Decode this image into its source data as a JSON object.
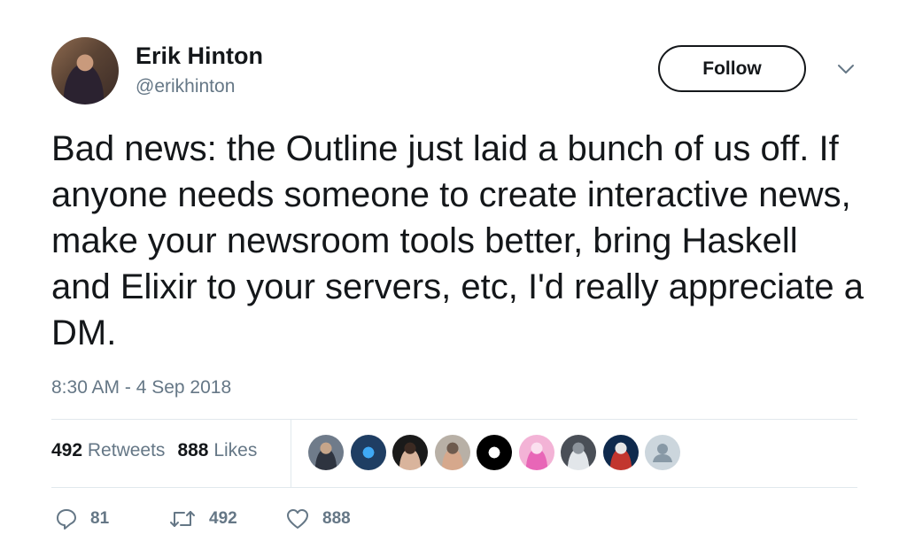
{
  "author": {
    "name": "Erik Hinton",
    "handle": "@erikhinton"
  },
  "follow_label": "Follow",
  "tweet_text": "Bad news: the Outline just laid a bunch of us off. If anyone needs someone to create interactive news, make your newsroom tools better, bring Haskell and Elixir to your servers, etc, I'd really appreciate a DM.",
  "timestamp": "8:30 AM - 4 Sep 2018",
  "stats": {
    "retweets_count": "492",
    "retweets_label": "Retweets",
    "likes_count": "888",
    "likes_label": "Likes"
  },
  "liker_avatars": [
    {
      "kind": "photo",
      "colors": [
        "#6f7b8a",
        "#2e3440",
        "#c6a58a"
      ]
    },
    {
      "kind": "logo",
      "colors": [
        "#1f3e63",
        "#3fa9f5",
        "#0c1a2b"
      ]
    },
    {
      "kind": "photo",
      "colors": [
        "#1a1a1a",
        "#d9b49c",
        "#3c2a22"
      ]
    },
    {
      "kind": "photo",
      "colors": [
        "#b8b0a6",
        "#d6a88c",
        "#6e5b4e"
      ]
    },
    {
      "kind": "logo",
      "colors": [
        "#000000",
        "#ffffff",
        "#222222"
      ]
    },
    {
      "kind": "photo",
      "colors": [
        "#f3b3d6",
        "#e866b7",
        "#fbe0ef"
      ]
    },
    {
      "kind": "photo",
      "colors": [
        "#4a4f57",
        "#e2e6ea",
        "#8d949c"
      ]
    },
    {
      "kind": "photo",
      "colors": [
        "#0f2a4d",
        "#c2362f",
        "#e6e6e6"
      ]
    },
    {
      "kind": "default",
      "colors": [
        "#ccd6dd",
        "#8899a6",
        "#ccd6dd"
      ]
    }
  ],
  "actions": {
    "reply_count": "81",
    "retweet_count": "492",
    "like_count": "888"
  },
  "colors": {
    "text": "#14171a",
    "secondary_text": "#657786",
    "divider": "#e1e8ed"
  },
  "icons": [
    "chevron-down-icon",
    "reply-icon",
    "retweet-icon",
    "heart-icon"
  ]
}
